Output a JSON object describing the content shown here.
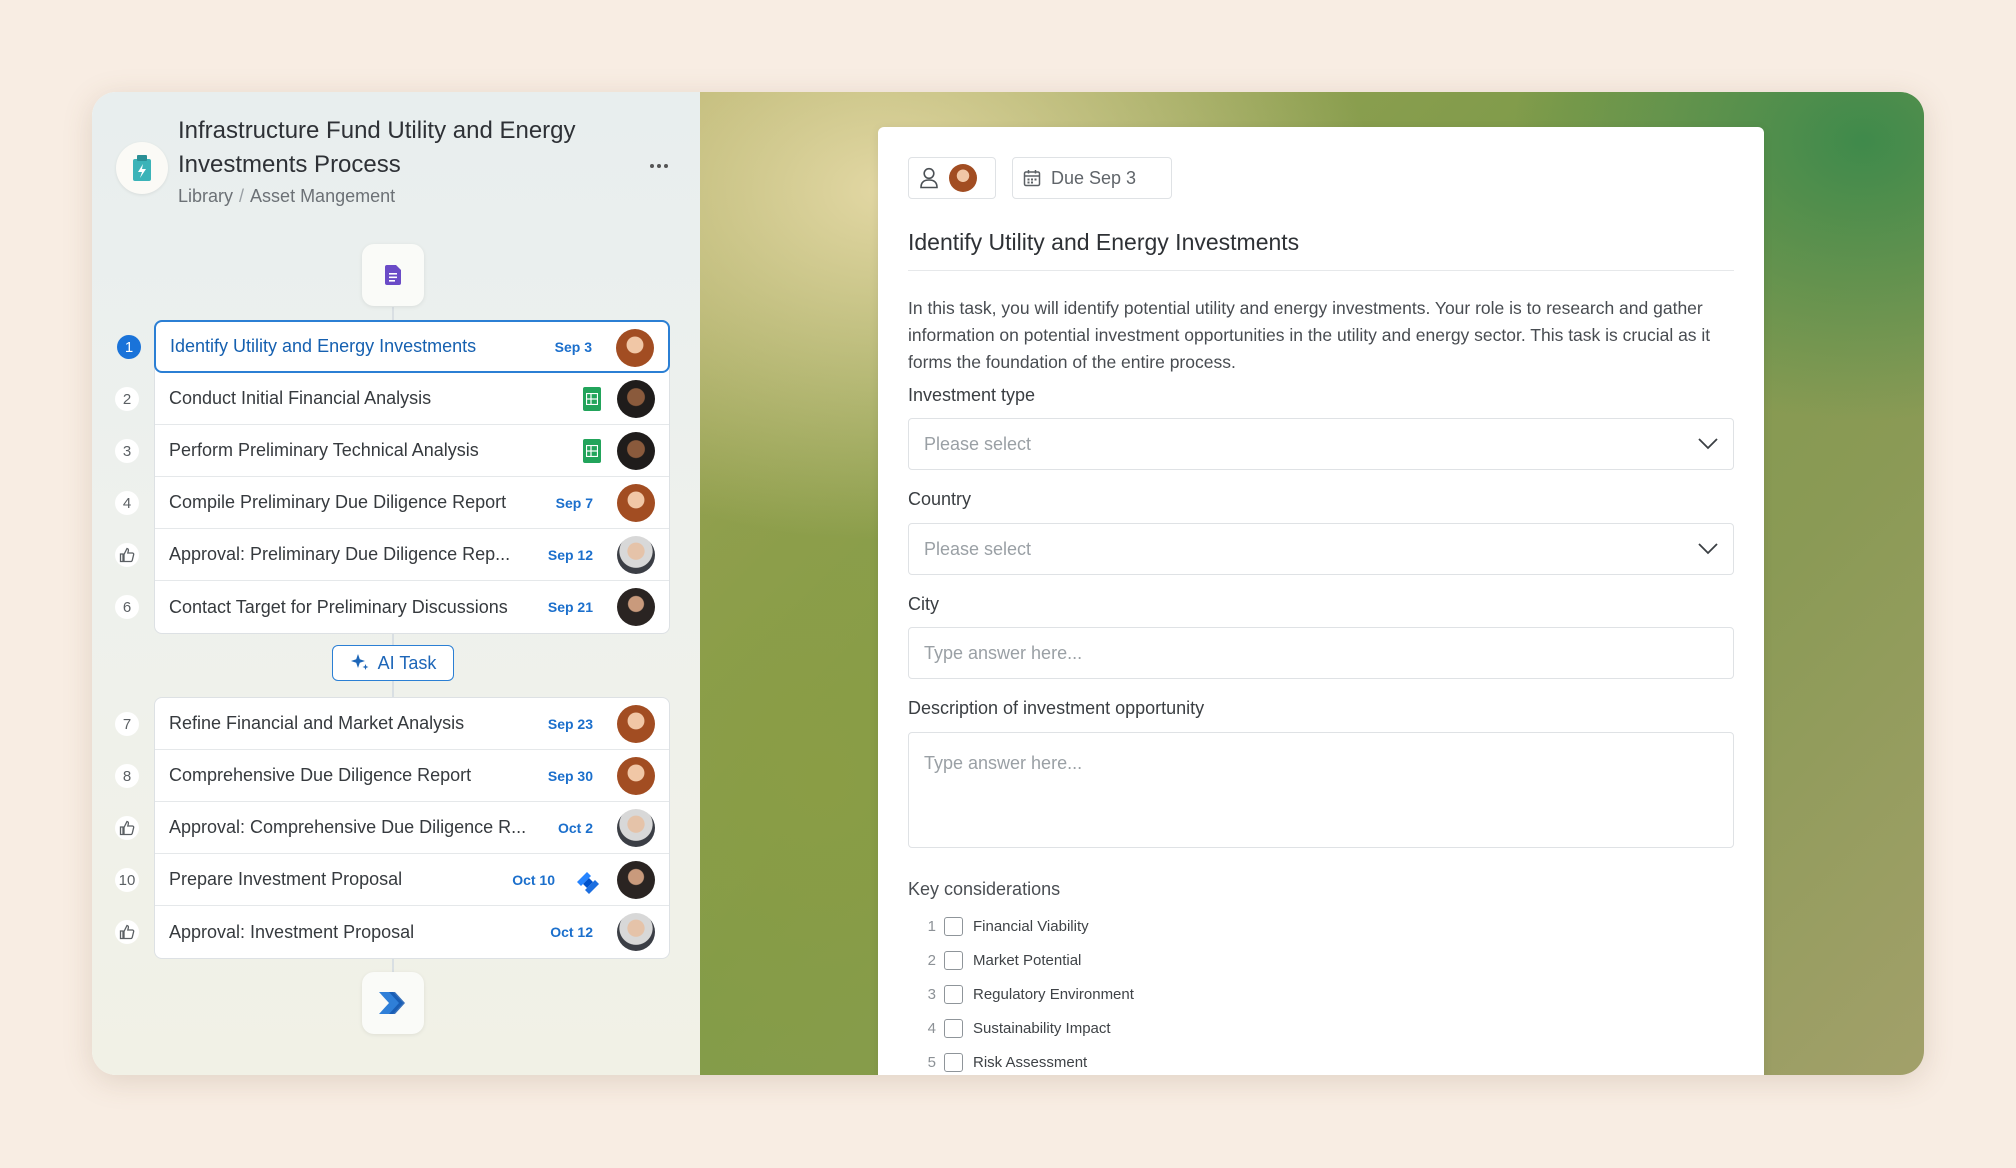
{
  "process": {
    "title": "Infrastructure Fund Utility and Energy Investments Process",
    "breadcrumb": [
      "Library",
      "Asset Mangement"
    ],
    "breadcrumb_sep": "/"
  },
  "tasks_group1": [
    {
      "num": "1",
      "label": "Identify Utility and Energy Investments",
      "due": "Sep 3",
      "avatar": "a",
      "active": true
    },
    {
      "num": "2",
      "label": "Conduct Initial Financial Analysis",
      "due": "",
      "sheet": true,
      "avatar": "b"
    },
    {
      "num": "3",
      "label": "Perform Preliminary Technical Analysis",
      "due": "",
      "sheet": true,
      "avatar": "b"
    },
    {
      "num": "4",
      "label": "Compile Preliminary Due Diligence Report",
      "due": "Sep 7",
      "avatar": "a"
    },
    {
      "num": "",
      "approval": true,
      "label": "Approval: Preliminary Due Diligence Rep...",
      "due": "Sep 12",
      "avatar": "c"
    },
    {
      "num": "6",
      "label": "Contact Target for Preliminary Discussions",
      "due": "Sep 21",
      "avatar": "d"
    }
  ],
  "ai_task_label": "AI Task",
  "tasks_group2": [
    {
      "num": "7",
      "label": "Refine Financial and Market Analysis",
      "due": "Sep 23",
      "avatar": "a"
    },
    {
      "num": "8",
      "label": "Comprehensive Due Diligence Report",
      "due": "Sep 30",
      "avatar": "a"
    },
    {
      "num": "",
      "approval": true,
      "label": "Approval: Comprehensive Due Diligence R...",
      "due": "Oct 2",
      "avatar": "c"
    },
    {
      "num": "10",
      "label": "Prepare Investment Proposal",
      "due": "Oct 10",
      "jira": true,
      "avatar": "d"
    },
    {
      "num": "",
      "approval": true,
      "label": "Approval: Investment Proposal",
      "due": "Oct 12",
      "avatar": "c"
    }
  ],
  "form": {
    "due_chip": "Due Sep 3",
    "title": "Identify Utility and Energy Investments",
    "description": "In this task, you will identify potential utility and energy investments. Your role is to research and gather information on potential investment opportunities in the utility and energy sector. This task is crucial as it forms the foundation of the entire process.",
    "investment_type_label": "Investment type",
    "investment_type_placeholder": "Please select",
    "country_label": "Country",
    "country_placeholder": "Please select",
    "city_label": "City",
    "city_placeholder": "Type answer here...",
    "desc_label": "Description of investment opportunity",
    "desc_placeholder": "Type answer here...",
    "key_considerations_label": "Key considerations",
    "key_considerations": [
      {
        "num": "1",
        "label": "Financial Viability"
      },
      {
        "num": "2",
        "label": "Market Potential"
      },
      {
        "num": "3",
        "label": "Regulatory Environment"
      },
      {
        "num": "4",
        "label": "Sustainability Impact"
      },
      {
        "num": "5",
        "label": "Risk Assessment"
      }
    ]
  },
  "colors": {
    "accent": "#1a73d9",
    "due": "#1b6fcc",
    "sheet": "#22a45b",
    "doc": "#6a4bc7"
  }
}
